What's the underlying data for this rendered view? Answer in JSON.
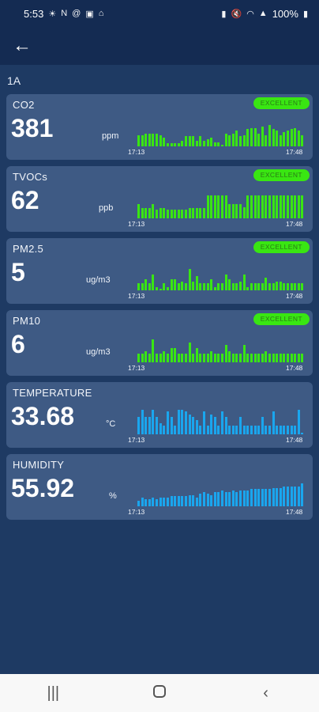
{
  "status_bar": {
    "time": "5:53",
    "battery": "100%"
  },
  "room": "1A",
  "cards": [
    {
      "key": "co2",
      "title": "CO2",
      "value": "381",
      "unit": "ppm",
      "badge": "EXCELLENT",
      "color": "#39e612",
      "time_start": "17:13",
      "time_end": "17:48",
      "levels": [
        0.4,
        0.4,
        0.45,
        0.45,
        0.45,
        0.45,
        0.4,
        0.3,
        0.1,
        0.1,
        0.1,
        0.1,
        0.2,
        0.35,
        0.35,
        0.35,
        0.2,
        0.35,
        0.2,
        0.25,
        0.3,
        0.15,
        0.15,
        0.05,
        0.45,
        0.4,
        0.45,
        0.55,
        0.35,
        0.4,
        0.6,
        0.65,
        0.65,
        0.45,
        0.7,
        0.4,
        0.75,
        0.6,
        0.55,
        0.4,
        0.5,
        0.55,
        0.6,
        0.65,
        0.55,
        0.4
      ]
    },
    {
      "key": "tvocs",
      "title": "TVOCs",
      "value": "62",
      "unit": "ppb",
      "badge": "EXCELLENT",
      "color": "#39e612",
      "time_start": "17:13",
      "time_end": "17:48",
      "levels": [
        0.5,
        0.35,
        0.35,
        0.35,
        0.5,
        0.3,
        0.35,
        0.35,
        0.3,
        0.3,
        0.3,
        0.3,
        0.3,
        0.3,
        0.35,
        0.35,
        0.35,
        0.35,
        0.35,
        0.8,
        0.8,
        0.8,
        0.8,
        0.8,
        0.8,
        0.5,
        0.5,
        0.5,
        0.5,
        0.4,
        0.8,
        0.8,
        0.8,
        0.8,
        0.8,
        0.8,
        0.8,
        0.8,
        0.8,
        0.8,
        0.8,
        0.8,
        0.8,
        0.8,
        0.8,
        0.8
      ]
    },
    {
      "key": "pm25",
      "title": "PM2.5",
      "value": "5",
      "unit": "ug/m3",
      "badge": "EXCELLENT",
      "color": "#39e612",
      "time_start": "17:13",
      "time_end": "17:48",
      "levels": [
        0.25,
        0.25,
        0.4,
        0.25,
        0.55,
        0.1,
        0.05,
        0.25,
        0.1,
        0.4,
        0.4,
        0.25,
        0.3,
        0.25,
        0.75,
        0.3,
        0.5,
        0.25,
        0.25,
        0.25,
        0.4,
        0.1,
        0.25,
        0.25,
        0.55,
        0.4,
        0.25,
        0.25,
        0.3,
        0.55,
        0.1,
        0.25,
        0.25,
        0.25,
        0.25,
        0.45,
        0.25,
        0.25,
        0.3,
        0.3,
        0.25,
        0.25,
        0.25,
        0.25,
        0.25,
        0.25
      ]
    },
    {
      "key": "pm10",
      "title": "PM10",
      "value": "6",
      "unit": "ug/m3",
      "badge": "EXCELLENT",
      "color": "#39e612",
      "time_start": "17:13",
      "time_end": "17:48",
      "levels": [
        0.3,
        0.3,
        0.4,
        0.3,
        0.8,
        0.3,
        0.3,
        0.4,
        0.3,
        0.5,
        0.5,
        0.3,
        0.3,
        0.3,
        0.7,
        0.3,
        0.5,
        0.3,
        0.3,
        0.3,
        0.4,
        0.3,
        0.3,
        0.3,
        0.6,
        0.4,
        0.3,
        0.3,
        0.3,
        0.6,
        0.3,
        0.3,
        0.3,
        0.3,
        0.3,
        0.4,
        0.3,
        0.3,
        0.3,
        0.3,
        0.3,
        0.3,
        0.3,
        0.3,
        0.3,
        0.3
      ]
    },
    {
      "key": "temperature",
      "title": "TEMPERATURE",
      "value": "33.68",
      "unit": "°C",
      "badge": "",
      "color": "#1aa6ee",
      "time_start": "17:13",
      "time_end": "17:48",
      "levels": [
        0.6,
        0.85,
        0.6,
        0.6,
        0.85,
        0.6,
        0.4,
        0.3,
        0.8,
        0.6,
        0.3,
        0.85,
        0.85,
        0.8,
        0.7,
        0.6,
        0.5,
        0.3,
        0.8,
        0.3,
        0.7,
        0.6,
        0.3,
        0.8,
        0.6,
        0.3,
        0.3,
        0.3,
        0.6,
        0.3,
        0.3,
        0.3,
        0.3,
        0.3,
        0.6,
        0.3,
        0.3,
        0.8,
        0.3,
        0.3,
        0.3,
        0.3,
        0.3,
        0.3,
        0.85,
        0.05
      ]
    },
    {
      "key": "humidity",
      "title": "HUMIDITY",
      "value": "55.92",
      "unit": "%",
      "badge": "",
      "color": "#1aa6ee",
      "time_start": "17:13",
      "time_end": "17:48",
      "levels": [
        0.2,
        0.3,
        0.25,
        0.25,
        0.3,
        0.25,
        0.3,
        0.3,
        0.3,
        0.35,
        0.35,
        0.35,
        0.35,
        0.35,
        0.4,
        0.4,
        0.3,
        0.45,
        0.5,
        0.45,
        0.4,
        0.5,
        0.5,
        0.55,
        0.5,
        0.5,
        0.55,
        0.5,
        0.55,
        0.55,
        0.55,
        0.6,
        0.6,
        0.6,
        0.6,
        0.6,
        0.6,
        0.65,
        0.65,
        0.65,
        0.7,
        0.7,
        0.7,
        0.7,
        0.7,
        0.8
      ]
    }
  ]
}
